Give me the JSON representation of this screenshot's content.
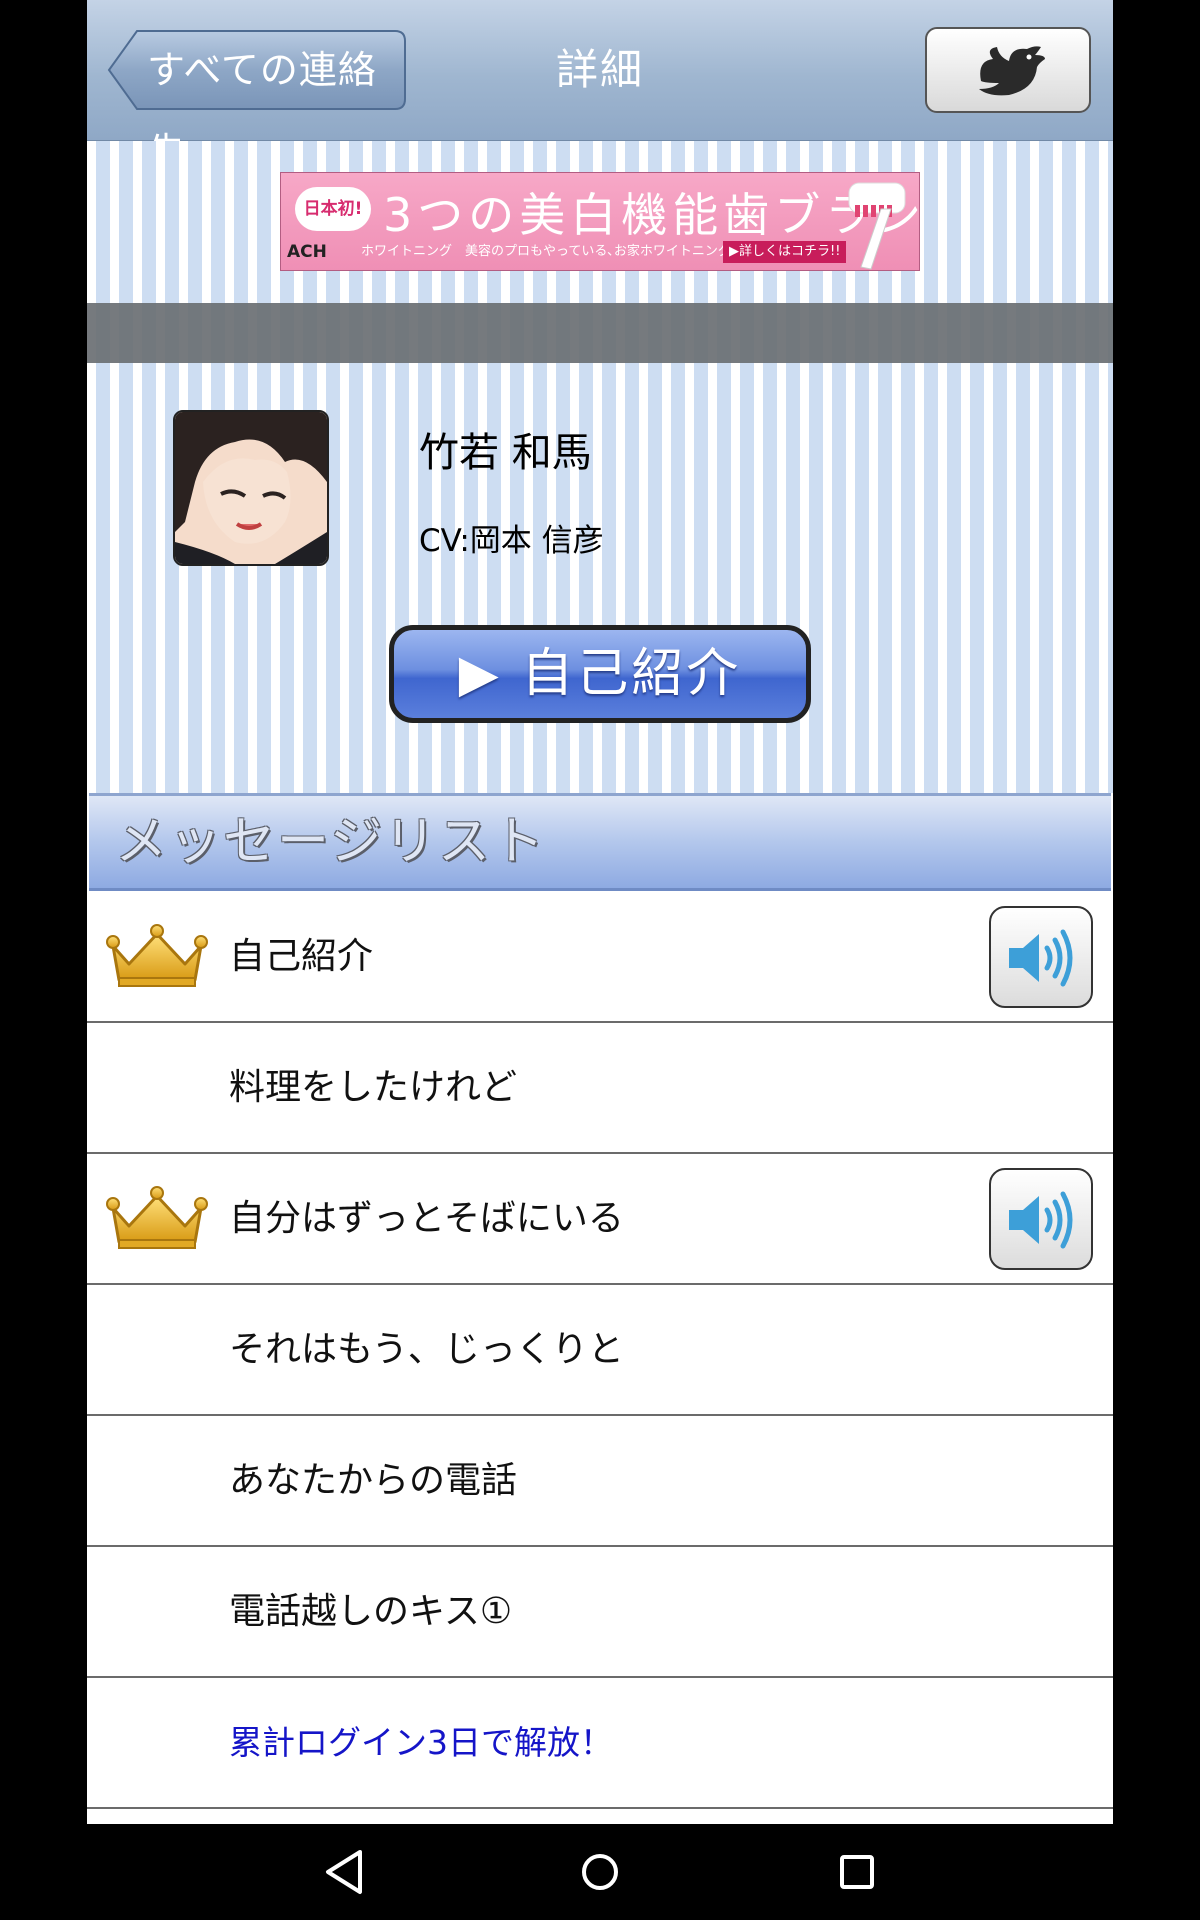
{
  "header": {
    "back_label": "すべての連絡先",
    "title": "詳細",
    "share_icon": "twitter-bird-icon"
  },
  "ad": {
    "badge": "日本初!",
    "headline": "3つの美白機能歯ブラシ",
    "brand": "ACH",
    "subtext": "ホワイトニング　美容のプロもやっている､お家ホワイトニング｡",
    "cta": "▶詳しくはコチラ!!"
  },
  "character": {
    "name": "竹若 和馬",
    "cv": "CV:岡本 信彦",
    "intro_button": "▶ 自己紹介"
  },
  "message_section": {
    "title": "メッセージリスト"
  },
  "messages": [
    {
      "label": "自己紹介",
      "crown": true,
      "sound": true,
      "locked": false
    },
    {
      "label": "料理をしたけれど",
      "crown": false,
      "sound": false,
      "locked": false
    },
    {
      "label": "自分はずっとそばにいる",
      "crown": true,
      "sound": true,
      "locked": false
    },
    {
      "label": "それはもう、じっくりと",
      "crown": false,
      "sound": false,
      "locked": false
    },
    {
      "label": "あなたからの電話",
      "crown": false,
      "sound": false,
      "locked": false
    },
    {
      "label": "電話越しのキス①",
      "crown": false,
      "sound": false,
      "locked": false
    },
    {
      "label": "累計ログイン3日で解放！",
      "crown": false,
      "sound": false,
      "locked": true
    }
  ],
  "colors": {
    "header": "#9fb6d0",
    "stripe": "#cdddf2",
    "intro_button": "#3f66cf",
    "crown": "#e8b52a",
    "locked_text": "#1515c8"
  },
  "navbar": {
    "back_icon": "nav-back-icon",
    "home_icon": "nav-home-icon",
    "recent_icon": "nav-recent-apps-icon"
  }
}
